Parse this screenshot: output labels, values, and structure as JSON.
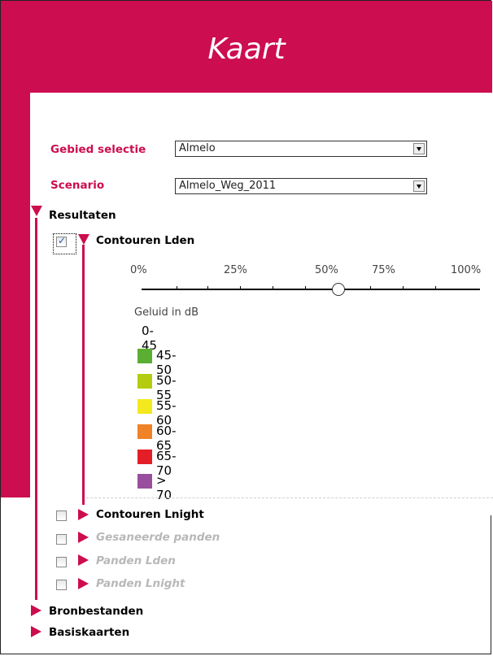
{
  "header": {
    "title": "Kaart"
  },
  "filters": {
    "gebied": {
      "label": "Gebied selectie",
      "value": "Almelo"
    },
    "scenario": {
      "label": "Scenario",
      "value": "Almelo_Weg_2011"
    }
  },
  "tree": {
    "resultaten": {
      "label": "Resultaten",
      "expanded": true
    },
    "contouren_lden": {
      "label": "Contouren Lden",
      "checked": true,
      "expanded": true
    },
    "contouren_lnight": {
      "label": "Contouren Lnight",
      "checked": false
    },
    "gesaneerde_panden": {
      "label": "Gesaneerde panden",
      "checked": false,
      "disabled": true
    },
    "panden_lden": {
      "label": "Panden Lden",
      "checked": false,
      "disabled": true
    },
    "panden_lnight": {
      "label": "Panden Lnight",
      "checked": false,
      "disabled": true
    },
    "bronbestanden": {
      "label": "Bronbestanden"
    },
    "basiskaarten": {
      "label": "Basiskaarten"
    }
  },
  "transparency_slider": {
    "ticks": [
      "0%",
      "25%",
      "50%",
      "75%",
      "100%"
    ],
    "value_percent": 58
  },
  "legend": {
    "title": "Geluid in dB",
    "items": [
      {
        "label": "0-45",
        "color": ""
      },
      {
        "label": "45-50",
        "color": "#5aae32"
      },
      {
        "label": "50-55",
        "color": "#b4cc0f"
      },
      {
        "label": "55-60",
        "color": "#f4e81e"
      },
      {
        "label": "60-65",
        "color": "#f08228"
      },
      {
        "label": "65-70",
        "color": "#e41e26"
      },
      {
        "label": "> 70",
        "color": "#9a4f9e"
      }
    ]
  },
  "colors": {
    "brand": "#cc0d4f",
    "disabled_text": "#b8b8b8"
  }
}
